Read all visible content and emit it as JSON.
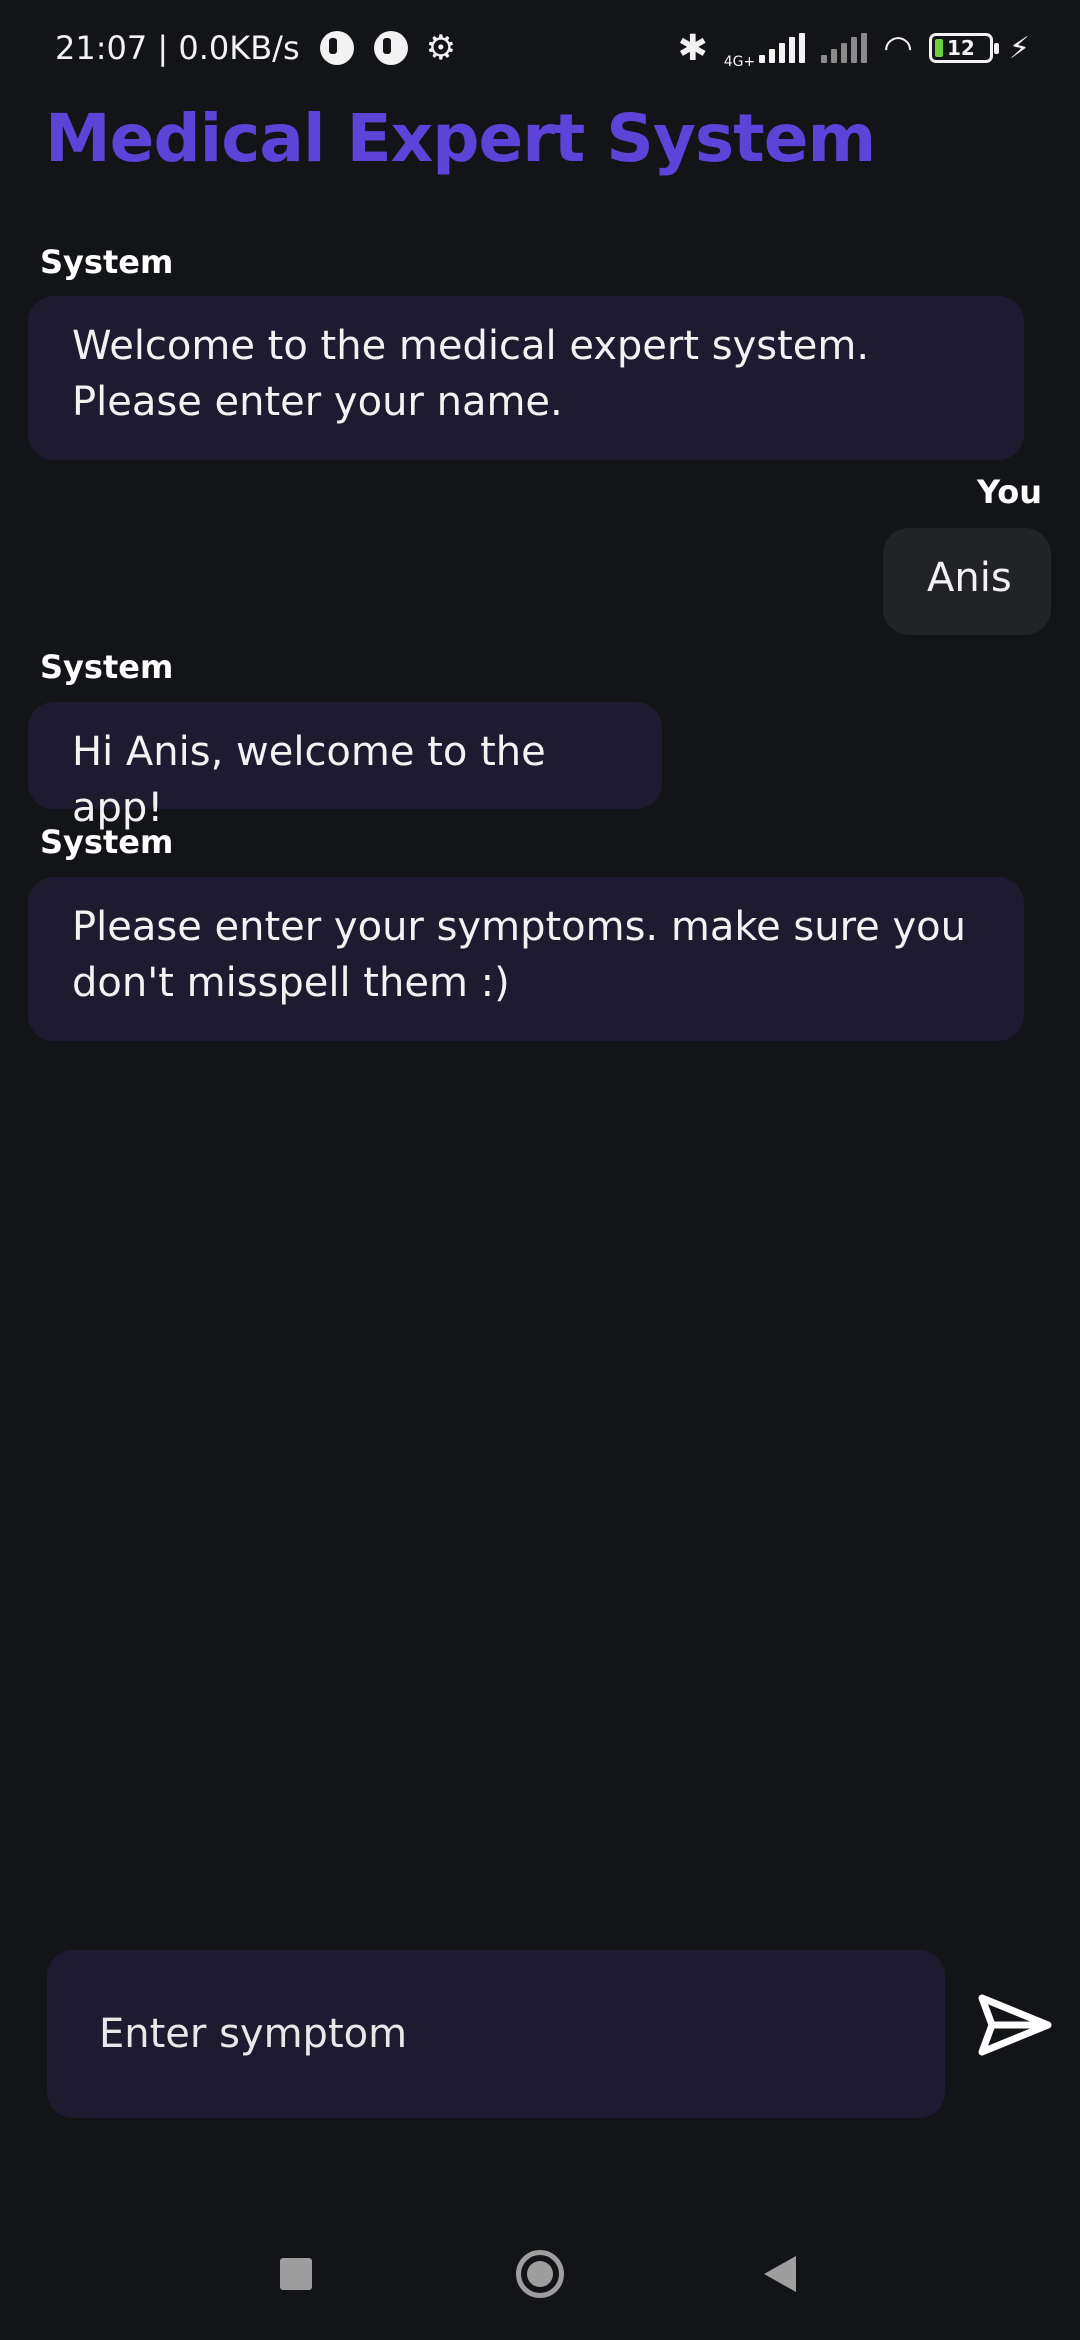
{
  "status_bar": {
    "time_speed": "21:07 | 0.0KB/s",
    "network_label": "4G+",
    "battery_level": "12",
    "icons": [
      "app-icon",
      "app-icon",
      "gear-icon",
      "bluetooth-icon",
      "signal-icon",
      "signal-icon",
      "wifi-icon",
      "battery-icon",
      "charging-icon"
    ]
  },
  "header": {
    "title": "Medical Expert System",
    "title_color": "#5e43d8"
  },
  "messages": [
    {
      "sender": "System",
      "text": "Welcome to the medical expert system. Please enter your name."
    },
    {
      "sender": "You",
      "text": "Anis"
    },
    {
      "sender": "System",
      "text": "Hi Anis, welcome to the app!"
    },
    {
      "sender": "System",
      "text": "Please enter your symptoms. make sure you don't misspell them :)"
    }
  ],
  "composer": {
    "placeholder": "Enter symptom",
    "send_icon": "send-icon"
  },
  "nav_bar": {
    "icons": [
      "recents-icon",
      "home-icon",
      "back-icon"
    ]
  },
  "colors": {
    "background": "#131418",
    "system_bubble": "#1e1b30",
    "user_bubble": "#222327",
    "accent": "#5e43d8"
  }
}
